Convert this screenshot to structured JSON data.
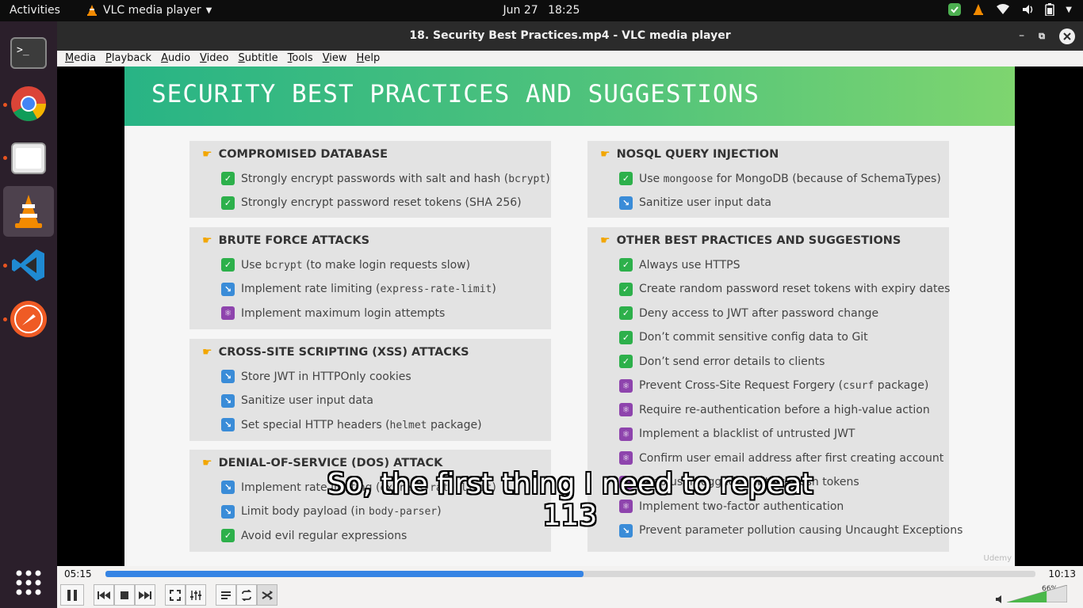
{
  "topbar": {
    "activities": "Activities",
    "app_name": "VLC media player",
    "date": "Jun 27",
    "time": "18:25"
  },
  "window": {
    "title": "18. Security Best Practices.mp4 - VLC media player"
  },
  "menu": [
    "Media",
    "Playback",
    "Audio",
    "Video",
    "Subtitle",
    "Tools",
    "View",
    "Help"
  ],
  "slide": {
    "title": "SECURITY BEST PRACTICES AND SUGGESTIONS",
    "cards": [
      {
        "title": "COMPROMISED DATABASE",
        "items": [
          {
            "icon": "check",
            "pre": "Strongly encrypt passwords with salt and hash (",
            "code": "bcrypt",
            "post": ")"
          },
          {
            "icon": "check",
            "pre": "Strongly encrypt password reset tokens (SHA 256)",
            "code": "",
            "post": ""
          }
        ]
      },
      {
        "title": "BRUTE FORCE ATTACKS",
        "items": [
          {
            "icon": "check",
            "pre": "Use ",
            "code": "bcrypt",
            "post": " (to make login requests slow)"
          },
          {
            "icon": "arrow",
            "pre": "Implement rate limiting (",
            "code": "express-rate-limit",
            "post": ")"
          },
          {
            "icon": "atom",
            "pre": "Implement maximum login attempts",
            "code": "",
            "post": ""
          }
        ]
      },
      {
        "title": "CROSS-SITE SCRIPTING (XSS) ATTACKS",
        "items": [
          {
            "icon": "arrow",
            "pre": "Store JWT in HTTPOnly cookies",
            "code": "",
            "post": ""
          },
          {
            "icon": "arrow",
            "pre": "Sanitize user input data",
            "code": "",
            "post": ""
          },
          {
            "icon": "arrow",
            "pre": "Set special HTTP headers (",
            "code": "helmet",
            "post": " package)"
          }
        ]
      },
      {
        "title": "DENIAL-OF-SERVICE (DOS) ATTACK",
        "items": [
          {
            "icon": "arrow",
            "pre": "Implement rate limiting (",
            "code": "express-rate-limit",
            "post": ")"
          },
          {
            "icon": "arrow",
            "pre": "Limit body payload (in ",
            "code": "body-parser",
            "post": ")"
          },
          {
            "icon": "check",
            "pre": "Avoid evil regular expressions",
            "code": "",
            "post": ""
          }
        ]
      },
      {
        "title": "NOSQL QUERY INJECTION",
        "items": [
          {
            "icon": "check",
            "pre": "Use ",
            "code": "mongoose",
            "post": " for MongoDB (because of SchemaTypes)"
          },
          {
            "icon": "arrow",
            "pre": "Sanitize user input data",
            "code": "",
            "post": ""
          }
        ]
      },
      {
        "title": "OTHER BEST PRACTICES AND SUGGESTIONS",
        "items": [
          {
            "icon": "check",
            "pre": "Always use HTTPS",
            "code": "",
            "post": ""
          },
          {
            "icon": "check",
            "pre": "Create random password reset tokens with expiry dates",
            "code": "",
            "post": ""
          },
          {
            "icon": "check",
            "pre": "Deny access to JWT after password change",
            "code": "",
            "post": ""
          },
          {
            "icon": "check",
            "pre": "Don’t commit sensitive config data to Git",
            "code": "",
            "post": ""
          },
          {
            "icon": "check",
            "pre": "Don’t send error details to clients",
            "code": "",
            "post": ""
          },
          {
            "icon": "atom",
            "pre": "Prevent Cross-Site Request Forgery (",
            "code": "csurf",
            "post": " package)"
          },
          {
            "icon": "atom",
            "pre": "Require re-authentication before a high-value action",
            "code": "",
            "post": ""
          },
          {
            "icon": "atom",
            "pre": "Implement a blacklist of untrusted JWT",
            "code": "",
            "post": ""
          },
          {
            "icon": "atom",
            "pre": "Confirm user email address after first creating account",
            "code": "",
            "post": ""
          },
          {
            "icon": "atom",
            "pre": "Keep user logged in with refresh tokens",
            "code": "",
            "post": ""
          },
          {
            "icon": "atom",
            "pre": "Implement two-factor authentication",
            "code": "",
            "post": ""
          },
          {
            "icon": "arrow",
            "pre": "Prevent parameter pollution causing Uncaught Exceptions",
            "code": "",
            "post": ""
          }
        ]
      }
    ],
    "watermark": "Udemy"
  },
  "subtitle": {
    "line1": "So, the first thing I need to repeat",
    "line2": "113"
  },
  "player": {
    "elapsed": "05:15",
    "total": "10:13",
    "progress": 0.514,
    "volume_label": "66%",
    "volume": 0.66
  },
  "colors": {
    "accent": "#3584e4",
    "header_green": "#55c57a",
    "check_green": "#2db04b",
    "arrow_blue": "#3a8cd8",
    "atom_purple": "#8e44ad",
    "dock_dot": "#e95420"
  }
}
